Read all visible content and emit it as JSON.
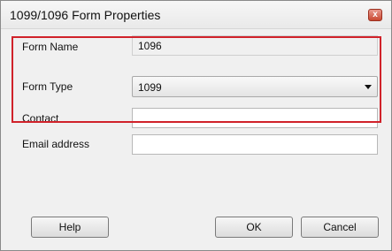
{
  "window": {
    "title": "1099/1096 Form Properties",
    "close_glyph": "x"
  },
  "form": {
    "form_name": {
      "label": "Form Name",
      "value": "1096"
    },
    "form_type": {
      "label": "Form Type",
      "selected": "1099"
    },
    "contact": {
      "label": "Contact",
      "value": ""
    },
    "email": {
      "label": "Email address",
      "value": ""
    }
  },
  "buttons": {
    "help": "Help",
    "ok": "OK",
    "cancel": "Cancel"
  },
  "colors": {
    "highlight_border": "#d0222a",
    "close_button": "#c8472f"
  },
  "icons": {
    "close": "close-icon",
    "dropdown": "chevron-down-icon"
  }
}
